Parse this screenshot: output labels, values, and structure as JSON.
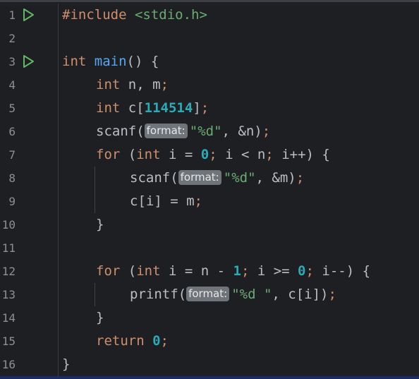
{
  "lines": [
    {
      "n": "1"
    },
    {
      "n": "2"
    },
    {
      "n": "3"
    },
    {
      "n": "4"
    },
    {
      "n": "5"
    },
    {
      "n": "6"
    },
    {
      "n": "7"
    },
    {
      "n": "8"
    },
    {
      "n": "9"
    },
    {
      "n": "10"
    },
    {
      "n": "11"
    },
    {
      "n": "12"
    },
    {
      "n": "13"
    },
    {
      "n": "14"
    },
    {
      "n": "15"
    },
    {
      "n": "16"
    }
  ],
  "code": {
    "l1": {
      "directive": "#include",
      "header": "<stdio.h>"
    },
    "l3": {
      "type": "int",
      "name": "main",
      "rest": "() {"
    },
    "l4": {
      "type": "int",
      "vars": "n, m",
      "semi": ";"
    },
    "l5": {
      "type": "int",
      "arr": "c[",
      "size": "114514",
      "close": "]",
      "semi": ";"
    },
    "l6": {
      "fn": "scanf(",
      "hint": "format:",
      "fmt": "\"%d\"",
      "args": ", &n)",
      "semi": ";"
    },
    "l7": {
      "kw_for": "for",
      "open": " (",
      "type": "int",
      "a": " i = ",
      "zero": "0",
      "semi1": ";",
      "b": " i < n",
      "semi2": ";",
      "c": " i++) {"
    },
    "l8": {
      "fn": "scanf(",
      "hint": "format:",
      "fmt": "\"%d\"",
      "args": ", &m)",
      "semi": ";"
    },
    "l9": {
      "text": "c[i] = m",
      "semi": ";"
    },
    "l10": {
      "text": "}"
    },
    "l12": {
      "kw_for": "for",
      "open": " (",
      "type": "int",
      "a": " i = n - ",
      "one": "1",
      "semi1": ";",
      "b": " i >= ",
      "zero": "0",
      "semi2": ";",
      "c": " i--) {"
    },
    "l13": {
      "fn": "printf(",
      "hint": "format:",
      "fmt": "\"%d \"",
      "args": ", c[i])",
      "semi": ";"
    },
    "l14": {
      "text": "}"
    },
    "l15": {
      "kw": "return",
      "zero": "0",
      "semi": ";"
    },
    "l16": {
      "text": "}"
    }
  },
  "colors": {
    "background": "#1e1f22",
    "keyword": "#cf8e6d",
    "string": "#6aab73",
    "number": "#2aacb8",
    "text": "#bcbec4",
    "run_icon": "#5fb865"
  }
}
